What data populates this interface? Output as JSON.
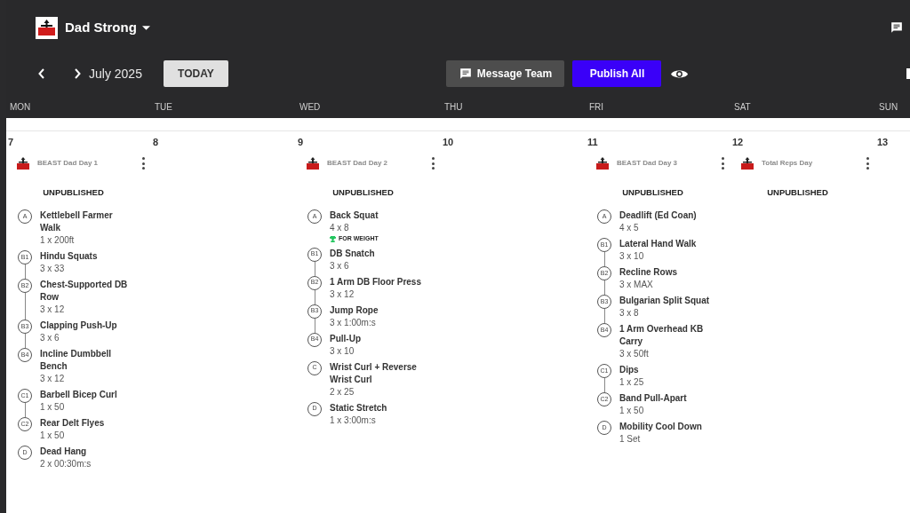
{
  "app": {
    "team_name": "Dad Strong"
  },
  "toolbar": {
    "month": "July 2025",
    "today_button": "TODAY",
    "message_button": "Message Team",
    "publish_button": "Publish All"
  },
  "weekdays": [
    "MON",
    "TUE",
    "WED",
    "THU",
    "FRI",
    "SAT",
    "SUN"
  ],
  "days": [
    {
      "date": "7",
      "workouts": [
        {
          "title": "BEAST Dad Day 1",
          "status": "UNPUBLISHED",
          "exercises": [
            {
              "label": "A",
              "name": "Kettlebell Farmer Walk",
              "sets": "1 x 200ft",
              "linked": false
            },
            {
              "label": "B1",
              "name": "Hindu Squats",
              "sets": "3 x 33",
              "linked": true
            },
            {
              "label": "B2",
              "name": "Chest-Supported DB Row",
              "sets": "3 x 12",
              "linked": true
            },
            {
              "label": "B3",
              "name": "Clapping Push-Up",
              "sets": "3 x 6",
              "linked": true
            },
            {
              "label": "B4",
              "name": "Incline Dumbbell Bench",
              "sets": "3 x 12",
              "linked": false
            },
            {
              "label": "C1",
              "name": "Barbell Bicep Curl",
              "sets": "1 x 50",
              "linked": true
            },
            {
              "label": "C2",
              "name": "Rear Delt Flyes",
              "sets": "1 x 50",
              "linked": false
            },
            {
              "label": "D",
              "name": "Dead Hang",
              "sets": "2 x 00:30m:s",
              "linked": false
            }
          ]
        }
      ]
    },
    {
      "date": "8"
    },
    {
      "date": "9",
      "workouts": [
        {
          "title": "BEAST Dad Day 2",
          "status": "UNPUBLISHED",
          "exercises": [
            {
              "label": "A",
              "name": "Back Squat",
              "sets": "4 x 8",
              "tag": "FOR WEIGHT",
              "linked": false
            },
            {
              "label": "B1",
              "name": "DB Snatch",
              "sets": "3 x 6",
              "linked": true
            },
            {
              "label": "B2",
              "name": "1 Arm DB Floor Press",
              "sets": "3 x 12",
              "linked": true
            },
            {
              "label": "B3",
              "name": "Jump Rope",
              "sets": "3 x 1:00m:s",
              "linked": true
            },
            {
              "label": "B4",
              "name": "Pull-Up",
              "sets": "3 x 10",
              "linked": false
            },
            {
              "label": "C",
              "name": "Wrist Curl + Reverse Wrist Curl",
              "sets": "2 x 25",
              "linked": false
            },
            {
              "label": "D",
              "name": "Static Stretch",
              "sets": "1 x 3:00m:s",
              "linked": false
            }
          ]
        }
      ]
    },
    {
      "date": "10"
    },
    {
      "date": "11",
      "workouts": [
        {
          "title": "BEAST Dad Day 3",
          "status": "UNPUBLISHED",
          "exercises": [
            {
              "label": "A",
              "name": "Deadlift (Ed Coan)",
              "sets": "4 x 5",
              "linked": false
            },
            {
              "label": "B1",
              "name": "Lateral Hand Walk",
              "sets": "3 x 10",
              "linked": true
            },
            {
              "label": "B2",
              "name": "Recline Rows",
              "sets": "3 x MAX",
              "linked": true
            },
            {
              "label": "B3",
              "name": "Bulgarian Split Squat",
              "sets": "3 x 8",
              "linked": true
            },
            {
              "label": "B4",
              "name": "1 Arm Overhead KB Carry",
              "sets": "3 x 50ft",
              "linked": false
            },
            {
              "label": "C1",
              "name": "Dips",
              "sets": "1 x 25",
              "linked": true
            },
            {
              "label": "C2",
              "name": "Band Pull-Apart",
              "sets": "1 x 50",
              "linked": false
            },
            {
              "label": "D",
              "name": "Mobility Cool Down",
              "sets": "1 Set",
              "linked": false
            }
          ]
        }
      ]
    },
    {
      "date": "12",
      "workouts": [
        {
          "title": "Total Reps Day",
          "status": "UNPUBLISHED"
        }
      ]
    },
    {
      "date": "13"
    }
  ]
}
